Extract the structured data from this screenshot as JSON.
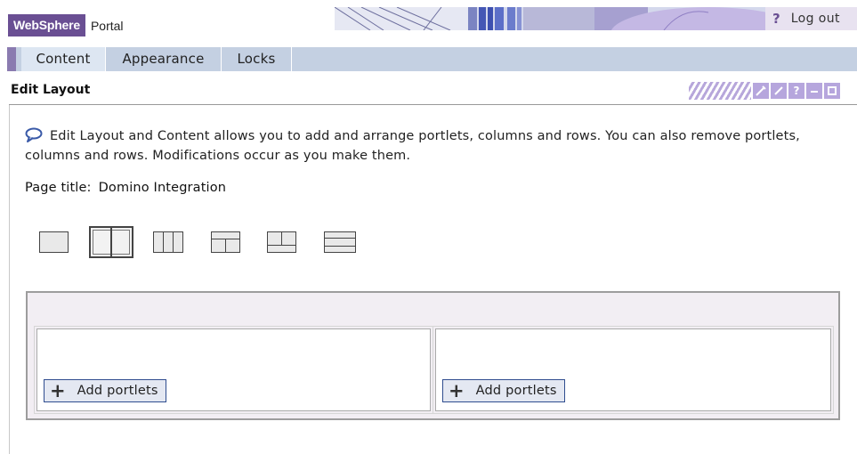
{
  "header": {
    "brand": "WebSphere",
    "product": "Portal",
    "help_icon_text": "?",
    "logout_label": "Log out"
  },
  "tabs": [
    {
      "label": "Content",
      "active": true
    },
    {
      "label": "Appearance",
      "active": false
    },
    {
      "label": "Locks",
      "active": false
    }
  ],
  "portlet": {
    "title": "Edit Layout",
    "tool_icons": [
      "edit-wrench-icon",
      "pencil-icon",
      "help-icon",
      "minimize-icon",
      "maximize-icon"
    ]
  },
  "content": {
    "description": "Edit Layout and Content allows you to add and arrange portlets, columns and rows. You can also remove portlets, columns and rows. Modifications occur as you make them.",
    "page_title_label": "Page title:",
    "page_title_value": "Domino Integration"
  },
  "layout_options": [
    {
      "name": "one-column-layout",
      "selected": false
    },
    {
      "name": "two-column-layout",
      "selected": true
    },
    {
      "name": "three-column-layout",
      "selected": false
    },
    {
      "name": "row-over-two-columns-layout",
      "selected": false
    },
    {
      "name": "two-columns-over-row-layout",
      "selected": false
    },
    {
      "name": "three-rows-layout",
      "selected": false
    }
  ],
  "columns": [
    {
      "add_label": "Add portlets"
    },
    {
      "add_label": "Add portlets"
    }
  ],
  "colors": {
    "brand_purple": "#6a4f93",
    "tab_bar": "#c4d0e2",
    "editor_bg": "#f2eef3",
    "add_button_border": "#2f4d8f"
  }
}
